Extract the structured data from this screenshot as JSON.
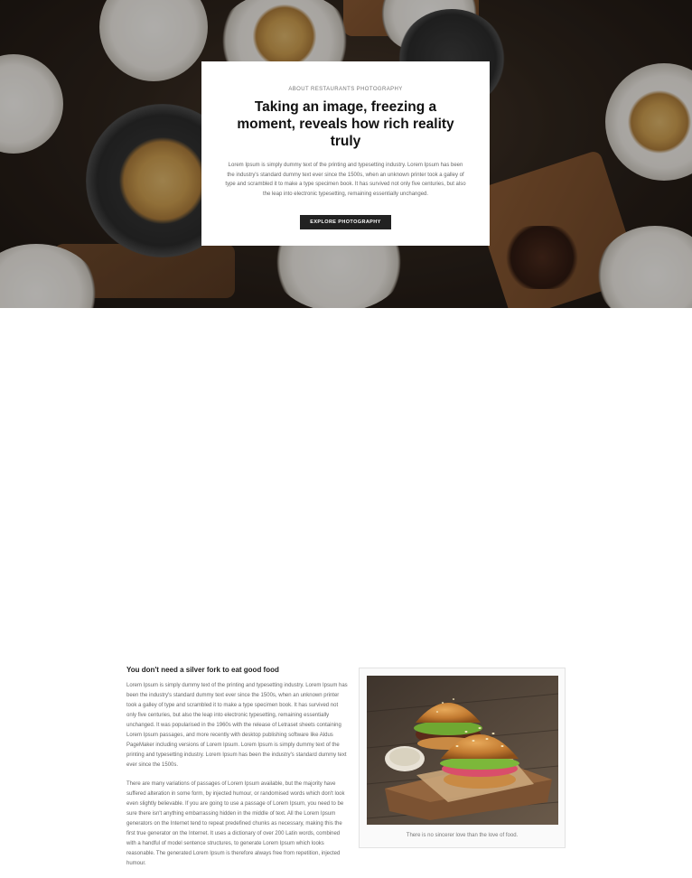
{
  "hero": {
    "eyebrow": "ABOUT RESTAURANTS PHOTOGRAPHY",
    "title": "Taking an image, freezing a moment, reveals how rich reality truly",
    "body": "Lorem Ipsum is simply dummy text of the printing and typesetting industry. Lorem Ipsum has been the industry's standard dummy text ever since the 1500s, when an unknown printer took a galley of type and scrambled it to make a type specimen book. It has survived not only five centuries, but also the leap into electronic typesetting, remaining essentially unchanged.",
    "button_label": "EXPLORE PHOTOGRAPHY"
  },
  "article": {
    "heading": "You don't need a silver fork to eat good food",
    "paragraph_1": "Lorem Ipsum is simply dummy text of the printing and typesetting industry. Lorem Ipsum has been the industry's standard dummy text ever since the 1500s, when an unknown printer took a galley of type and scrambled it to make a type specimen book. It has survived not only five centuries, but also the leap into electronic typesetting, remaining essentially unchanged. It was popularised in the 1960s with the release of Letraset sheets containing Lorem Ipsum passages, and more recently with desktop publishing software like Aldus PageMaker including versions of Lorem Ipsum. Lorem Ipsum is simply dummy text of the printing and typesetting industry. Lorem Ipsum has been the industry's standard dummy text ever since the 1500s.",
    "paragraph_2": "There are many variations of passages of Lorem Ipsum available, but the majority have suffered alteration in some form, by injected humour, or randomised words which don't look even slightly believable. If you are going to use a passage of Lorem Ipsum, you need to be sure there isn't anything embarrassing hidden in the middle of text. All the Lorem Ipsum generators on the Internet tend to repeat predefined chunks as necessary, making this the first true generator on the Internet. It uses a dictionary of over 200 Latin words, combined with a handful of model sentence structures, to generate Lorem Ipsum which looks reasonable. The generated Lorem Ipsum is therefore always free from repetition, injected humour."
  },
  "figure": {
    "caption": "There is no sincerer love than the love of food."
  }
}
